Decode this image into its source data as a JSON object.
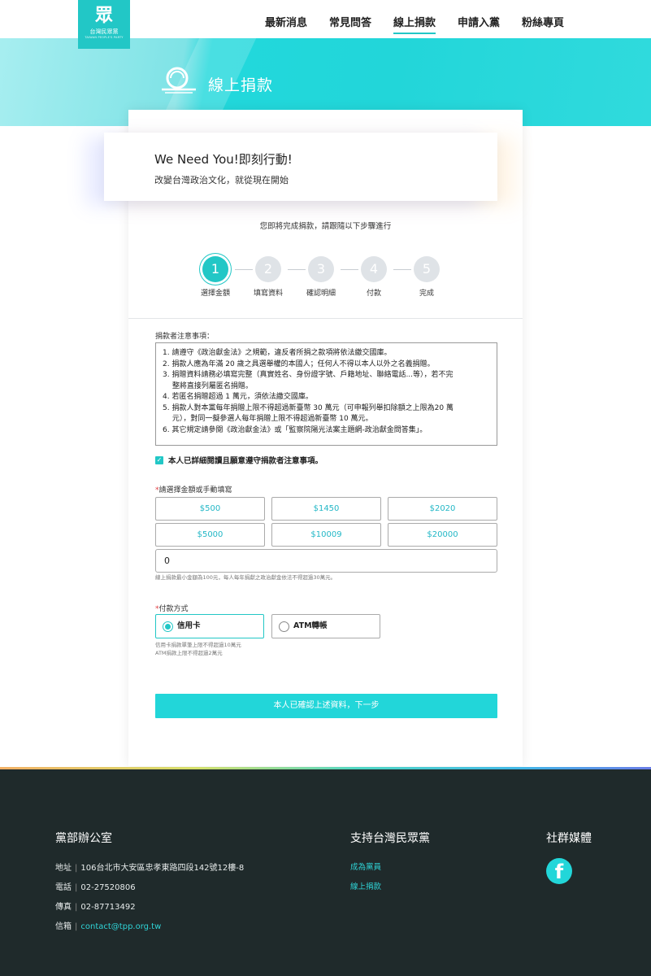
{
  "logo": {
    "mark": "眾",
    "name": "台灣民眾黨",
    "sub": "TAIWAN PEOPLE'S PARTY"
  },
  "nav": [
    {
      "label": "最新消息"
    },
    {
      "label": "常見問答"
    },
    {
      "label": "線上捐款",
      "active": true
    },
    {
      "label": "申請入黨"
    },
    {
      "label": "粉絲專頁"
    }
  ],
  "banner": {
    "title": "線上捐款"
  },
  "hero": {
    "title": "We Need You!即刻行動!",
    "subtitle": "改變台灣政治文化，就從現在開始"
  },
  "intro": "您即將完成捐款，請跟隨以下步驟進行",
  "steps": [
    {
      "num": "1",
      "label": "選擇金額",
      "active": true
    },
    {
      "num": "2",
      "label": "填寫資料"
    },
    {
      "num": "3",
      "label": "確認明細"
    },
    {
      "num": "4",
      "label": "付款"
    },
    {
      "num": "5",
      "label": "完成"
    }
  ],
  "notice": {
    "label": "捐款者注意事項：",
    "lines": [
      "1. 請遵守《政治獻金法》之規範，違反者所捐之款項將依法繳交國庫。",
      "2. 捐款人應為年滿 20 歲之具選舉權的本國人；任何人不得以本人以外之名義捐贈。",
      "3. 捐贈資料請務必填寫完整（真實姓名、身份證字號、戶籍地址、聯絡電話...等），若不完",
      "　 整將直接列屬匿名捐贈。",
      "4. 若匿名捐贈超過 1 萬元，須依法繳交國庫。",
      "5. 捐款人對本黨每年捐贈上限不得超過新臺幣 30 萬元（可申報列舉扣除額之上限為20 萬",
      "　 元），對同一擬參選人每年捐贈上限不得超過新臺幣 10 萬元。",
      "6. 其它規定請參閱《政治獻金法》或「監察院陽光法案主題網-政治獻金問答集」。"
    ]
  },
  "agree": {
    "label": "本人已詳細閱讀且願意遵守捐款者注意事項。",
    "checked": true
  },
  "amount": {
    "label": "請選擇金額或手動填寫",
    "options": [
      "$500",
      "$1450",
      "$2020",
      "$5000",
      "$10009",
      "$20000"
    ],
    "value": "0",
    "note": "線上捐款最小金額為100元，每人每年捐獻之政治獻金依法不得超過30萬元。"
  },
  "payment": {
    "label": "付款方式",
    "options": [
      {
        "label": "信用卡",
        "selected": true
      },
      {
        "label": "ATM轉帳",
        "selected": false
      }
    ],
    "note1": "信用卡捐款單筆上限不得超過10萬元",
    "note2": "ATM捐款上限不得超過2萬元"
  },
  "submit": {
    "label": "本人已確認上述資料，下一步"
  },
  "footer": {
    "office": {
      "title": "黨部辦公室",
      "address_label": "地址",
      "address": "106台北市大安區忠孝東路四段142號12樓-8",
      "phone_label": "電話",
      "phone": "02-27520806",
      "fax_label": "傳真",
      "fax": "02-87713492",
      "email_label": "信箱",
      "email": "contact@tpp.org.tw"
    },
    "support": {
      "title": "支持台灣民眾黨",
      "links": [
        "成為黨員",
        "線上捐款"
      ]
    },
    "social": {
      "title": "社群媒體",
      "facebook_icon": "facebook-icon"
    }
  },
  "colors": {
    "accent": "#22c7c6",
    "footer_bg": "#1f2a2b"
  }
}
